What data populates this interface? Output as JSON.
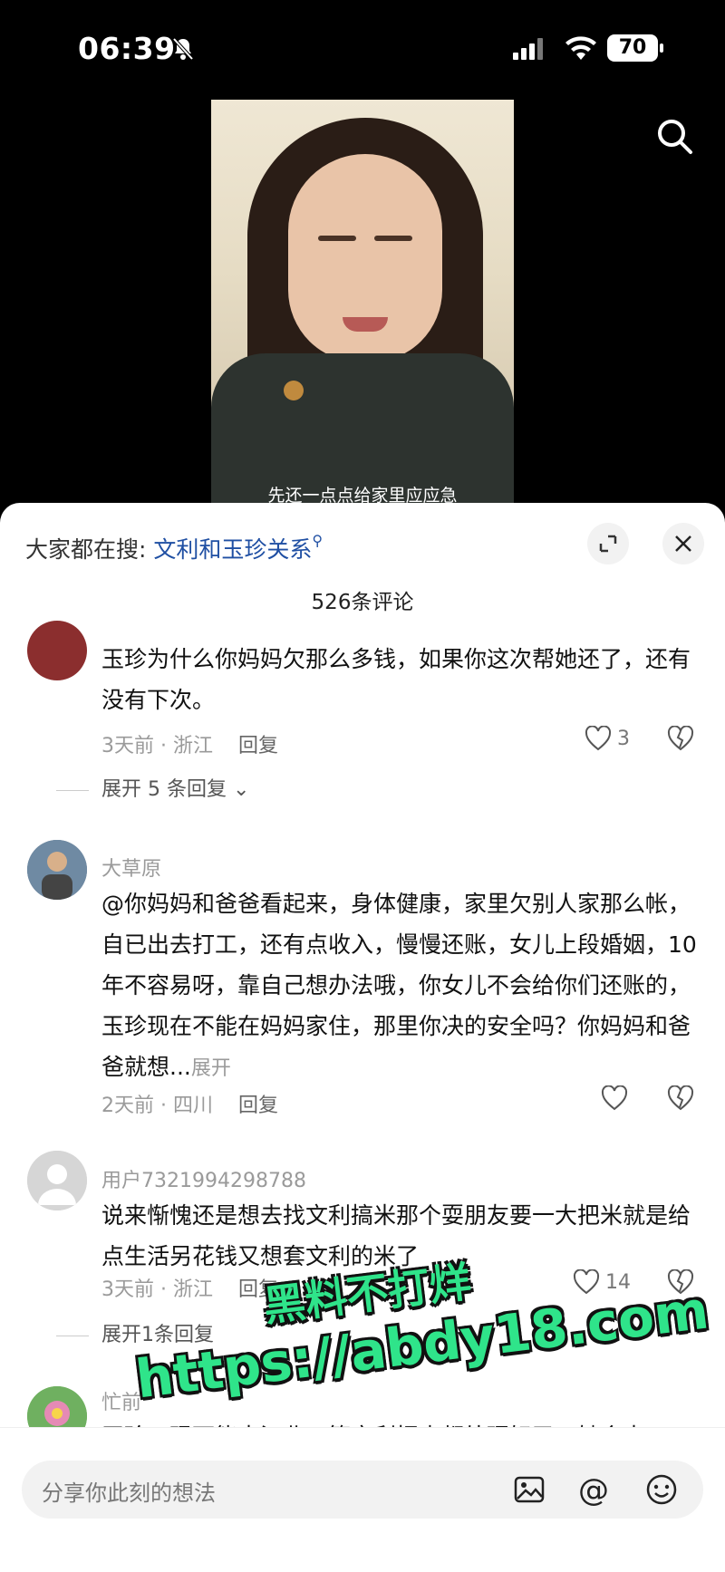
{
  "status_bar": {
    "time": "06:39",
    "battery": "70"
  },
  "video": {
    "subtitle": "先还一点点给家里应应急"
  },
  "comments_panel": {
    "search_prefix": "大家都在搜:",
    "search_link": "文利和玉珍关系",
    "comment_count": "526条评论",
    "comments": [
      {
        "text": "玉珍为什么你妈妈欠那么多钱，如果你这次帮她还了，还有没有下次。",
        "time_location": "3天前 · 浙江",
        "reply": "回复",
        "likes": "3",
        "expand": "展开 5 条回复"
      },
      {
        "username": "大草原",
        "text": "@你妈妈和爸爸看起来，身体健康，家里欠别人家那么帐，自已出去打工，还有点收入，慢慢还账，女儿上段婚姻，10年不容易呀，靠自己想办法哦，你女儿不会给你们还账的，玉珍现在不能在妈妈家住，那里你决的安全吗？你妈妈和爸爸就想...",
        "more": "展开",
        "time_location": "2天前 · 四川",
        "reply": "回复"
      },
      {
        "username": "用户7321994298788",
        "text": "说来惭愧还是想去找文利搞米那个耍朋友要一大把米就是给点生活另花钱又想套文利的米了",
        "time_location": "3天前 · 浙江",
        "reply": "回复",
        "likes": "14",
        "expand": "展开1条回复"
      },
      {
        "username": "忙前",
        "text": "玉珍，现下能去江北，等文利把事都处理好了，她会去"
      }
    ],
    "input_placeholder": "分享你此刻的想法"
  },
  "watermark": {
    "line1": "黑料不打烊",
    "line2": "https://abdy18.com"
  },
  "colors": {
    "accent_link": "#1f4fa3",
    "watermark": "#2fe48a"
  }
}
